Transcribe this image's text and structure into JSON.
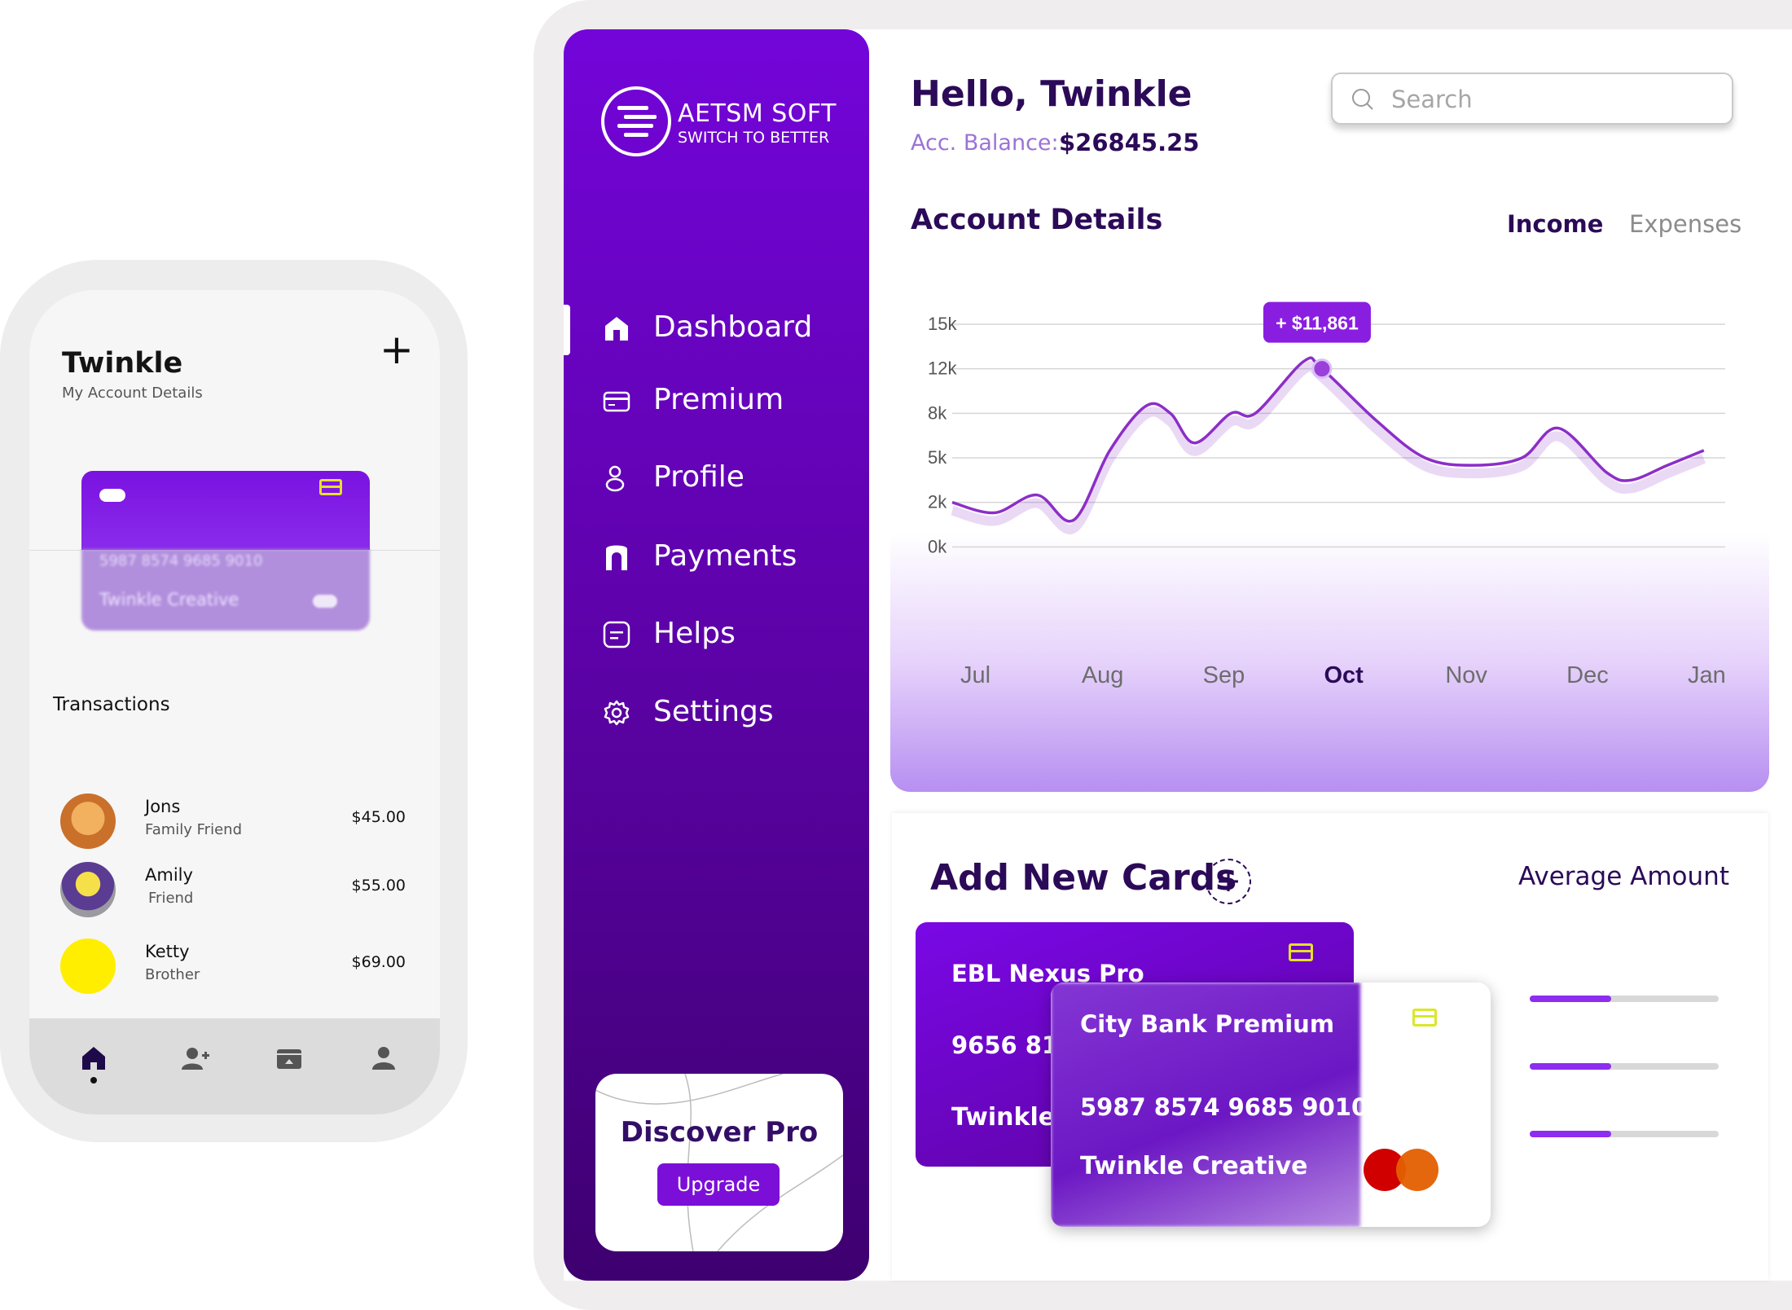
{
  "phone": {
    "title": "Twinkle",
    "subtitle": "My Account Details",
    "add_icon": "plus-icon",
    "card": {
      "number": "5987 8574 9685 9010",
      "holder": "Twinkle Creative",
      "chip_icon": "card-chip-icon"
    },
    "transactions_title": "Transactions",
    "transactions": [
      {
        "name": "Jons",
        "relation": "Family Friend",
        "amount": "$45.00",
        "avatar_color": "#c9702b"
      },
      {
        "name": "Amily",
        "relation": "Friend",
        "amount": "$55.00",
        "avatar_color": "#8d8d92"
      },
      {
        "name": "Ketty",
        "relation": "Brother",
        "amount": "$69.00",
        "avatar_color": "#ffee00"
      }
    ],
    "nav": [
      {
        "icon": "home-icon",
        "active": true
      },
      {
        "icon": "add-user-icon",
        "active": false
      },
      {
        "icon": "store-icon",
        "active": false
      },
      {
        "icon": "user-icon",
        "active": false
      }
    ]
  },
  "sidebar": {
    "logo_name": "AETSM SOFT",
    "logo_tagline": "SWITCH TO BETTER",
    "items": [
      {
        "label": "Dashboard",
        "icon": "home-icon",
        "active": true
      },
      {
        "label": "Premium",
        "icon": "credit-card-icon",
        "active": false
      },
      {
        "label": "Profile",
        "icon": "person-icon",
        "active": false
      },
      {
        "label": "Payments",
        "icon": "payments-icon",
        "active": false
      },
      {
        "label": "Helps",
        "icon": "help-icon",
        "active": false
      },
      {
        "label": "Settings",
        "icon": "gear-icon",
        "active": false
      }
    ],
    "promo": {
      "title": "Discover Pro",
      "button": "Upgrade"
    }
  },
  "header": {
    "greeting": "Hello, Twinkle",
    "balance_label": "Acc. Balance:",
    "balance_value": "$26845.25",
    "search_placeholder": "Search"
  },
  "account_details": {
    "title": "Account Details",
    "tabs": [
      {
        "label": "Income",
        "active": true
      },
      {
        "label": "Expenses",
        "active": false
      }
    ]
  },
  "chart_data": {
    "type": "line",
    "title": "",
    "xlabel": "",
    "ylabel": "",
    "categories": [
      "Jul",
      "Aug",
      "Sep",
      "Oct",
      "Nov",
      "Dec",
      "Jan"
    ],
    "highlight_category": "Oct",
    "y_ticks": [
      "15k",
      "12k",
      "8k",
      "5k",
      "2k",
      "0k"
    ],
    "ylim": [
      0,
      15
    ],
    "grid": true,
    "line_color": "#8c2ec8",
    "series": [
      {
        "x": [
          0,
          0.35,
          0.7,
          1.0,
          1.3,
          1.6,
          1.8,
          2.0,
          2.3,
          2.5,
          2.9,
          3.05,
          3.5,
          3.9,
          4.3,
          4.7,
          5.0,
          5.4,
          5.6,
          5.9,
          6.2
        ],
        "values": [
          3.0,
          2.3,
          3.5,
          1.8,
          6.5,
          9.5,
          9.0,
          7.0,
          9.0,
          9.0,
          12.5,
          12.0,
          8.5,
          6.0,
          5.5,
          6.0,
          8.0,
          5.0,
          4.5,
          5.5,
          6.5
        ]
      }
    ],
    "tooltip": {
      "label": "+ $11,861",
      "x": 3.05,
      "y": 12.0
    }
  },
  "cards_section": {
    "title": "Add New Cards",
    "add_icon": "plus-icon",
    "average_title": "Average Amount",
    "averages": [
      0.43,
      0.43,
      0.43
    ],
    "cards": [
      {
        "name": "EBL Nexus Pro",
        "number": "9656 812",
        "holder": "Twinkle"
      },
      {
        "name": "City Bank Premium",
        "number": "5987 8574 9685 9010",
        "holder": "Twinkle Creative",
        "brand_icon": "mastercard-icon"
      }
    ]
  }
}
